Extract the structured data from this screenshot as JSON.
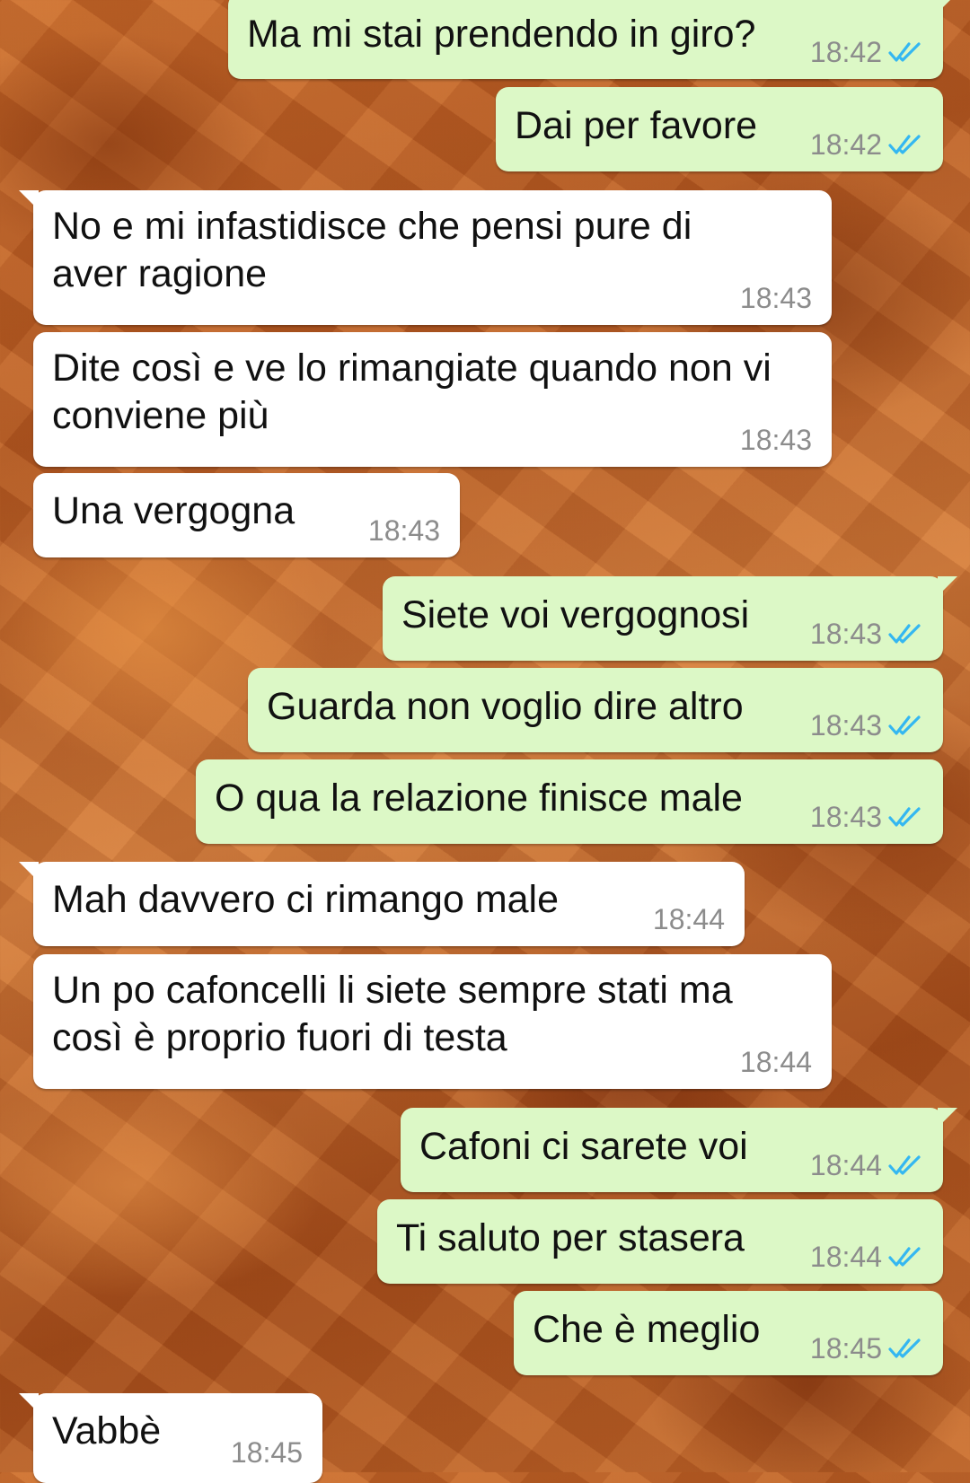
{
  "colors": {
    "incoming_bubble": "#ffffff",
    "outgoing_bubble": "#dcf8c6",
    "time_text": "#8c8c8c",
    "read_ticks": "#34b7f1"
  },
  "messages": [
    {
      "direction": "outgoing",
      "text": "Ma mi stai prendendo in giro?",
      "time": "18:42",
      "status_icon": "double-check-read-icon"
    },
    {
      "direction": "outgoing",
      "text": "Dai per favore",
      "time": "18:42",
      "status_icon": "double-check-read-icon"
    },
    {
      "direction": "incoming",
      "text": "No e mi infastidisce che pensi pure di\naver ragione",
      "time": "18:43"
    },
    {
      "direction": "incoming",
      "text": "Dite così e ve lo rimangiate quando non vi\nconviene più",
      "time": "18:43"
    },
    {
      "direction": "incoming",
      "text": "Una vergogna",
      "time": "18:43"
    },
    {
      "direction": "outgoing",
      "text": "Siete voi vergognosi",
      "time": "18:43",
      "status_icon": "double-check-read-icon"
    },
    {
      "direction": "outgoing",
      "text": "Guarda non voglio dire altro",
      "time": "18:43",
      "status_icon": "double-check-read-icon"
    },
    {
      "direction": "outgoing",
      "text": "O qua la relazione finisce male",
      "time": "18:43",
      "status_icon": "double-check-read-icon"
    },
    {
      "direction": "incoming",
      "text": "Mah davvero ci rimango male",
      "time": "18:44"
    },
    {
      "direction": "incoming",
      "text": "Un po cafoncelli li siete sempre stati ma\ncosì è proprio fuori di testa",
      "time": "18:44"
    },
    {
      "direction": "outgoing",
      "text": "Cafoni ci sarete voi",
      "time": "18:44",
      "status_icon": "double-check-read-icon"
    },
    {
      "direction": "outgoing",
      "text": "Ti saluto per stasera",
      "time": "18:44",
      "status_icon": "double-check-read-icon"
    },
    {
      "direction": "outgoing",
      "text": "Che è meglio",
      "time": "18:45",
      "status_icon": "double-check-read-icon"
    },
    {
      "direction": "incoming",
      "text": "Vabbè",
      "time": "18:45"
    }
  ]
}
